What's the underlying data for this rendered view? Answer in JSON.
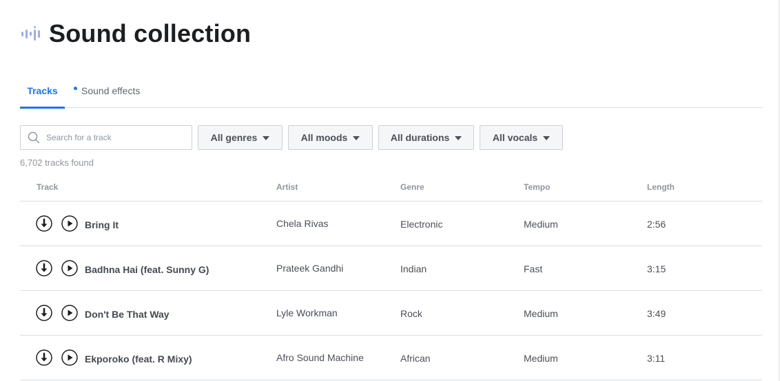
{
  "header": {
    "title": "Sound collection",
    "icon": "sound-wave-icon"
  },
  "tabs": [
    {
      "label": "Tracks",
      "active": true
    },
    {
      "label": "Sound effects",
      "active": false,
      "has_dot": true
    }
  ],
  "search": {
    "placeholder": "Search for a track",
    "value": "",
    "icon": "search-icon"
  },
  "filters": [
    {
      "label": "All genres",
      "icon": "caret-down-icon"
    },
    {
      "label": "All moods",
      "icon": "caret-down-icon"
    },
    {
      "label": "All durations",
      "icon": "caret-down-icon"
    },
    {
      "label": "All vocals",
      "icon": "caret-down-icon"
    }
  ],
  "result_count": "6,702 tracks found",
  "table": {
    "columns": [
      "Track",
      "Artist",
      "Genre",
      "Tempo",
      "Length"
    ],
    "rows": [
      {
        "track": "Bring It",
        "artist": "Chela Rivas",
        "genre": "Electronic",
        "tempo": "Medium",
        "length": "2:56"
      },
      {
        "track": "Badhna Hai (feat. Sunny G)",
        "artist": "Prateek Gandhi",
        "genre": "Indian",
        "tempo": "Fast",
        "length": "3:15"
      },
      {
        "track": "Don't Be That Way",
        "artist": "Lyle Workman",
        "genre": "Rock",
        "tempo": "Medium",
        "length": "3:49"
      },
      {
        "track": "Ekporoko (feat. R Mixy)",
        "artist": "Afro Sound Machine",
        "genre": "African",
        "tempo": "Medium",
        "length": "3:11"
      }
    ],
    "row_icons": [
      "download-icon",
      "play-icon"
    ]
  },
  "colors": {
    "accent": "#1877f2",
    "title_text": "#1c1e21",
    "muted_text": "#90949c",
    "body_text": "#4b4f56",
    "divider": "#dadde1",
    "filter_bg": "#f5f6f7"
  }
}
